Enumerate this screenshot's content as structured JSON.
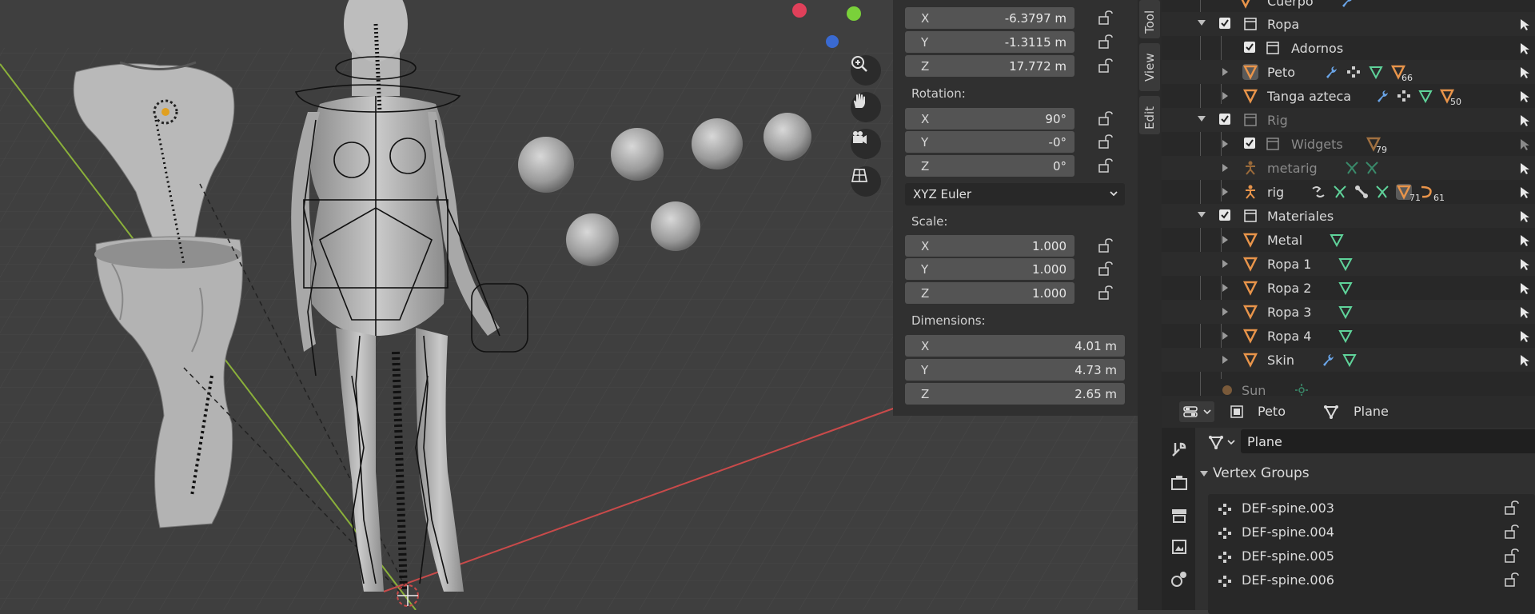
{
  "viewport": {
    "nav_tools": [
      "zoom-tool",
      "pan-tool",
      "camera-view-tool",
      "orthographic-toggle"
    ]
  },
  "npanel": {
    "location": [
      {
        "axis": "X",
        "value": "-6.3797 m"
      },
      {
        "axis": "Y",
        "value": "-1.3115 m"
      },
      {
        "axis": "Z",
        "value": "17.772 m"
      }
    ],
    "rotation_label": "Rotation:",
    "rotation": [
      {
        "axis": "X",
        "value": "90°"
      },
      {
        "axis": "Y",
        "value": "-0°"
      },
      {
        "axis": "Z",
        "value": "0°"
      }
    ],
    "rotation_mode": "XYZ Euler",
    "scale_label": "Scale:",
    "scale": [
      {
        "axis": "X",
        "value": "1.000"
      },
      {
        "axis": "Y",
        "value": "1.000"
      },
      {
        "axis": "Z",
        "value": "1.000"
      }
    ],
    "dimensions_label": "Dimensions:",
    "dimensions": [
      {
        "axis": "X",
        "value": "4.01 m"
      },
      {
        "axis": "Y",
        "value": "4.73 m"
      },
      {
        "axis": "Z",
        "value": "2.65 m"
      }
    ]
  },
  "tabs": [
    "Tool",
    "View",
    "Edit"
  ],
  "outliner": {
    "rows": [
      {
        "label": "Cuerpo",
        "kind": "mesh"
      },
      {
        "label": "Ropa",
        "kind": "collection"
      },
      {
        "label": "Adornos",
        "kind": "collection"
      },
      {
        "label": "Peto",
        "kind": "mesh",
        "badge": "66"
      },
      {
        "label": "Tanga azteca",
        "kind": "mesh",
        "badge": "50"
      },
      {
        "label": "Rig",
        "kind": "collection"
      },
      {
        "label": "Widgets",
        "kind": "collection",
        "badge": "79"
      },
      {
        "label": "metarig",
        "kind": "armature"
      },
      {
        "label": "rig",
        "kind": "armature",
        "badge": "71",
        "badge2": "61"
      },
      {
        "label": "Materiales",
        "kind": "collection"
      },
      {
        "label": "Metal",
        "kind": "mesh"
      },
      {
        "label": "Ropa 1",
        "kind": "mesh"
      },
      {
        "label": "Ropa 2",
        "kind": "mesh"
      },
      {
        "label": "Ropa 3",
        "kind": "mesh"
      },
      {
        "label": "Ropa 4",
        "kind": "mesh"
      },
      {
        "label": "Skin",
        "kind": "mesh"
      },
      {
        "label": "Sun",
        "kind": "light"
      }
    ]
  },
  "properties": {
    "header_object": "Peto",
    "header_data": "Plane",
    "mesh_name": "Plane",
    "panel_title": "Vertex Groups",
    "vertex_groups": [
      "DEF-spine.003",
      "DEF-spine.004",
      "DEF-spine.005",
      "DEF-spine.006"
    ]
  },
  "colors": {
    "mesh_orange": "#e8944a",
    "data_green": "#5fd39a",
    "selection_blue": "#334d80",
    "axis_red": "#c94a4a",
    "axis_green": "#8ab03a"
  }
}
